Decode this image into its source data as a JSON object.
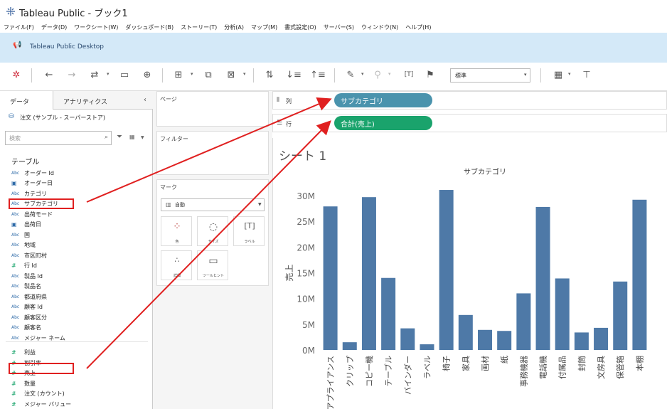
{
  "window": {
    "title": "Tableau Public - ブック1"
  },
  "menu": [
    "ファイル(F)",
    "データ(D)",
    "ワークシート(W)",
    "ダッシュボード(B)",
    "ストーリー(T)",
    "分析(A)",
    "マップ(M)",
    "書式設定(O)",
    "サーバー(S)",
    "ウィンドウ(N)",
    "ヘルプ(H)"
  ],
  "banner": {
    "text": "Tableau Public Desktop",
    "icon": "megaphone-icon"
  },
  "toolbar": {
    "fit_value": "標準"
  },
  "data_pane": {
    "tab_data": "データ",
    "tab_analytics": "アナリティクス",
    "datasource": "注文 (サンプル - スーパーストア)",
    "search_placeholder": "検索",
    "tables_heading": "テーブル",
    "fields": [
      {
        "type": "Abc",
        "name": "オーダー Id"
      },
      {
        "type": "date",
        "name": "オーダー日"
      },
      {
        "type": "Abc",
        "name": "カテゴリ"
      },
      {
        "type": "Abc",
        "name": "サブカテゴリ"
      },
      {
        "type": "Abc",
        "name": "出荷モード"
      },
      {
        "type": "date",
        "name": "出荷日"
      },
      {
        "type": "Abc",
        "name": "国"
      },
      {
        "type": "Abc",
        "name": "地域"
      },
      {
        "type": "Abc",
        "name": "市区町村"
      },
      {
        "type": "#",
        "name": "行 Id"
      },
      {
        "type": "Abc",
        "name": "製品 Id"
      },
      {
        "type": "Abc",
        "name": "製品名"
      },
      {
        "type": "Abc",
        "name": "都道府県"
      },
      {
        "type": "Abc",
        "name": "顧客 Id"
      },
      {
        "type": "Abc",
        "name": "顧客区分"
      },
      {
        "type": "Abc",
        "name": "顧客名"
      },
      {
        "type": "Abc",
        "name": "メジャー ネーム"
      },
      {
        "type": "#",
        "name": "利益"
      },
      {
        "type": "#",
        "name": "割引率"
      },
      {
        "type": "#",
        "name": "売上"
      },
      {
        "type": "#",
        "name": "数量"
      },
      {
        "type": "#",
        "name": "注文 (カウント)"
      },
      {
        "type": "#",
        "name": "メジャー バリュー"
      }
    ]
  },
  "cards": {
    "pages": "ページ",
    "filters": "フィルター",
    "marks": "マーク",
    "marks_type": "自動",
    "mark_buttons": [
      "色",
      "サイズ",
      "ラベル",
      "詳細",
      "ツールヒント"
    ]
  },
  "shelves": {
    "columns_label": "列",
    "rows_label": "行",
    "columns_pill": "サブカテゴリ",
    "rows_pill": "合計(売上)"
  },
  "sheet": {
    "title": "シート 1"
  },
  "colors": {
    "bar": "#4e79a7",
    "pill_dimension": "#4a93ad",
    "pill_measure": "#1aa36c",
    "annotation": "#e02020",
    "banner": "#d4e9f8"
  },
  "chart_data": {
    "type": "bar",
    "title": "サブカテゴリ",
    "xlabel": "",
    "ylabel": "売上",
    "categories": [
      "アプライアンス",
      "クリップ",
      "コピー機",
      "テーブル",
      "バインダー",
      "ラベル",
      "椅子",
      "家具",
      "画材",
      "紙",
      "事務機器",
      "電話機",
      "付属品",
      "封筒",
      "文房具",
      "保管箱",
      "本棚"
    ],
    "values": [
      27900000,
      1500000,
      29700000,
      14000000,
      4200000,
      1100000,
      31100000,
      6800000,
      3900000,
      3700000,
      11000000,
      27800000,
      13900000,
      3400000,
      4300000,
      13300000,
      29200000
    ],
    "yticks": [
      "0M",
      "5M",
      "10M",
      "15M",
      "20M",
      "25M",
      "30M"
    ],
    "ylim": [
      0,
      32000000
    ],
    "grid": false
  }
}
